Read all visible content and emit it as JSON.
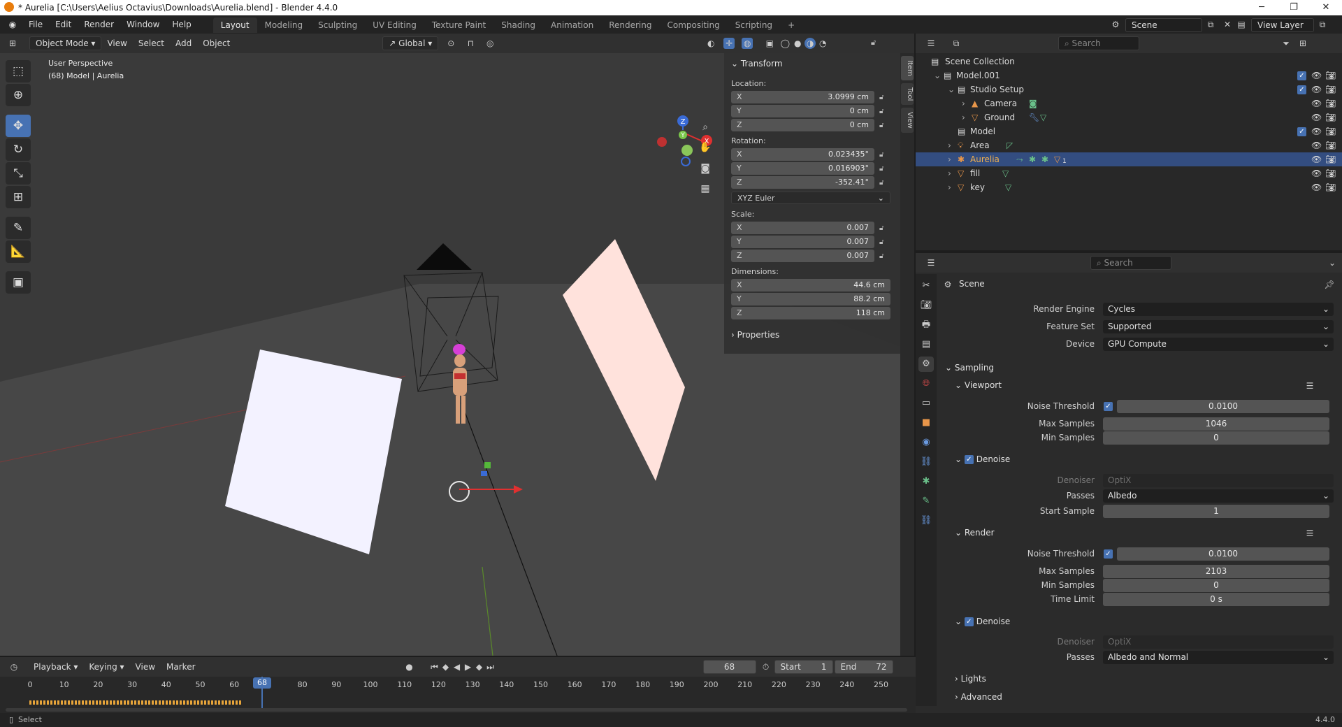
{
  "window": {
    "title": "* Aurelia [C:\\Users\\Aelius Octavius\\Downloads\\Aurelia.blend] - Blender 4.4.0",
    "min": "─",
    "max": "❐",
    "close": "✕"
  },
  "menu": [
    "File",
    "Edit",
    "Render",
    "Window",
    "Help"
  ],
  "workspaces": [
    "Layout",
    "Modeling",
    "Sculpting",
    "UV Editing",
    "Texture Paint",
    "Shading",
    "Animation",
    "Rendering",
    "Compositing",
    "Scripting",
    "+"
  ],
  "topright": {
    "scene": "Scene",
    "view_layer": "View Layer"
  },
  "viewport_header": {
    "mode": "Object Mode",
    "menus": [
      "View",
      "Select",
      "Add",
      "Object"
    ],
    "orientation": "Global"
  },
  "viewport": {
    "perspective": "User Perspective",
    "info": "(68) Model | Aurelia",
    "gizmo": {
      "x": "X",
      "y": "Y",
      "z": "Z"
    }
  },
  "npanel": {
    "section": "Transform",
    "location_label": "Location:",
    "location": [
      {
        "axis": "X",
        "value": "3.0999 cm"
      },
      {
        "axis": "Y",
        "value": "0 cm"
      },
      {
        "axis": "Z",
        "value": "0 cm"
      }
    ],
    "rotation_label": "Rotation:",
    "rotation": [
      {
        "axis": "X",
        "value": "0.023435°"
      },
      {
        "axis": "Y",
        "value": "0.016903°"
      },
      {
        "axis": "Z",
        "value": "-352.41°"
      }
    ],
    "rotation_mode": "XYZ Euler",
    "scale_label": "Scale:",
    "scale": [
      {
        "axis": "X",
        "value": "0.007"
      },
      {
        "axis": "Y",
        "value": "0.007"
      },
      {
        "axis": "Z",
        "value": "0.007"
      }
    ],
    "dimensions_label": "Dimensions:",
    "dimensions": [
      {
        "axis": "X",
        "value": "44.6 cm"
      },
      {
        "axis": "Y",
        "value": "88.2 cm"
      },
      {
        "axis": "Z",
        "value": "118 cm"
      }
    ],
    "properties": "Properties",
    "tabs": [
      "Item",
      "Tool",
      "View"
    ]
  },
  "outliner": {
    "search_placeholder": "Search",
    "rows": [
      {
        "name": "Scene Collection",
        "indent": 0
      },
      {
        "name": "Model.001",
        "indent": 1
      },
      {
        "name": "Studio Setup",
        "indent": 2
      },
      {
        "name": "Camera",
        "indent": 3
      },
      {
        "name": "Ground",
        "indent": 3
      },
      {
        "name": "Model",
        "indent": 2
      },
      {
        "name": "Area",
        "indent": 2
      },
      {
        "name": "Aurelia",
        "indent": 2
      },
      {
        "name": "fill",
        "indent": 2
      },
      {
        "name": "key",
        "indent": 2
      }
    ],
    "modifier_badge": "1"
  },
  "properties": {
    "search_placeholder": "Search",
    "context": "Scene",
    "render_engine_label": "Render Engine",
    "render_engine": "Cycles",
    "feature_set_label": "Feature Set",
    "feature_set": "Supported",
    "device_label": "Device",
    "device": "GPU Compute",
    "sampling": "Sampling",
    "viewport": "Viewport",
    "noise_threshold_label": "Noise Threshold",
    "vp_noise": "0.0100",
    "max_samples_label": "Max Samples",
    "vp_max": "1046",
    "min_samples_label": "Min Samples",
    "vp_min": "0",
    "denoise": "Denoise",
    "denoiser_label": "Denoiser",
    "denoiser": "OptiX",
    "passes_label": "Passes",
    "vp_passes": "Albedo",
    "start_sample_label": "Start Sample",
    "start_sample": "1",
    "render": "Render",
    "r_noise": "0.0100",
    "r_max": "2103",
    "r_min": "0",
    "time_limit_label": "Time Limit",
    "time_limit": "0 s",
    "r_passes": "Albedo and Normal",
    "lights": "Lights",
    "advanced": "Advanced"
  },
  "timeline": {
    "menus": [
      "Playback",
      "Keying",
      "View",
      "Marker"
    ],
    "current_frame": "68",
    "start_label": "Start",
    "start": "1",
    "end_label": "End",
    "end": "72",
    "ticks": [
      "0",
      "10",
      "20",
      "30",
      "40",
      "50",
      "60",
      "80",
      "90",
      "100",
      "110",
      "120",
      "130",
      "140",
      "150",
      "160",
      "170",
      "180",
      "190",
      "200",
      "210",
      "220",
      "230",
      "240",
      "250"
    ]
  },
  "status": {
    "left": "Select",
    "version": "4.4.0"
  }
}
